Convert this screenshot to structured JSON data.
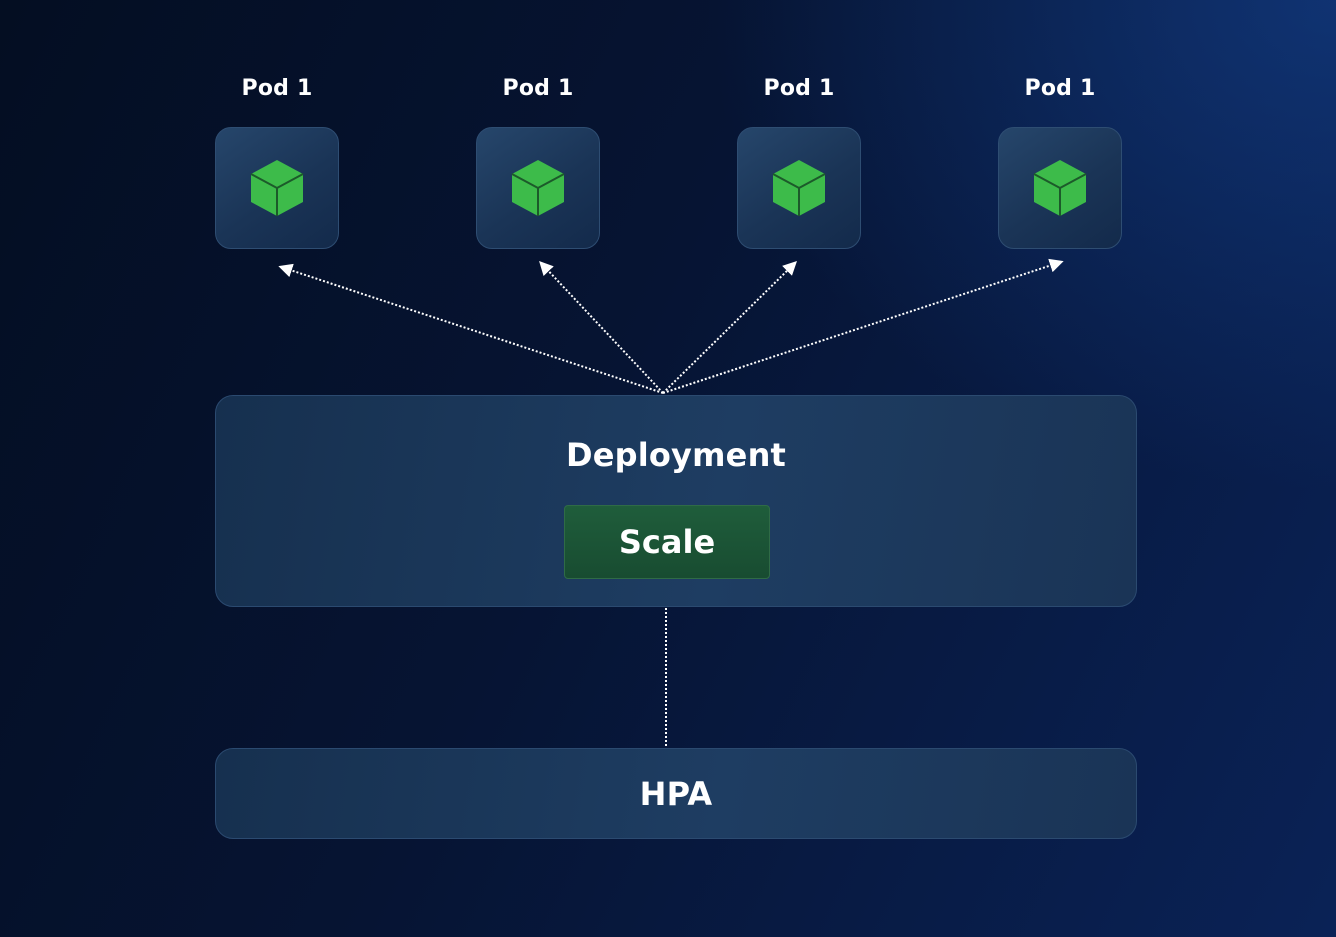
{
  "pods": [
    {
      "label": "Pod 1",
      "icon": "cube-icon"
    },
    {
      "label": "Pod 1",
      "icon": "cube-icon"
    },
    {
      "label": "Pod 1",
      "icon": "cube-icon"
    },
    {
      "label": "Pod 1",
      "icon": "cube-icon"
    }
  ],
  "deployment": {
    "title": "Deployment",
    "scale_label": "Scale"
  },
  "hpa": {
    "title": "HPA"
  },
  "colors": {
    "cube_green": "#3dbb4a",
    "cube_edge": "#1c5a2a",
    "connector": "#ffffff",
    "scale_fill": "#1f5d3b"
  }
}
